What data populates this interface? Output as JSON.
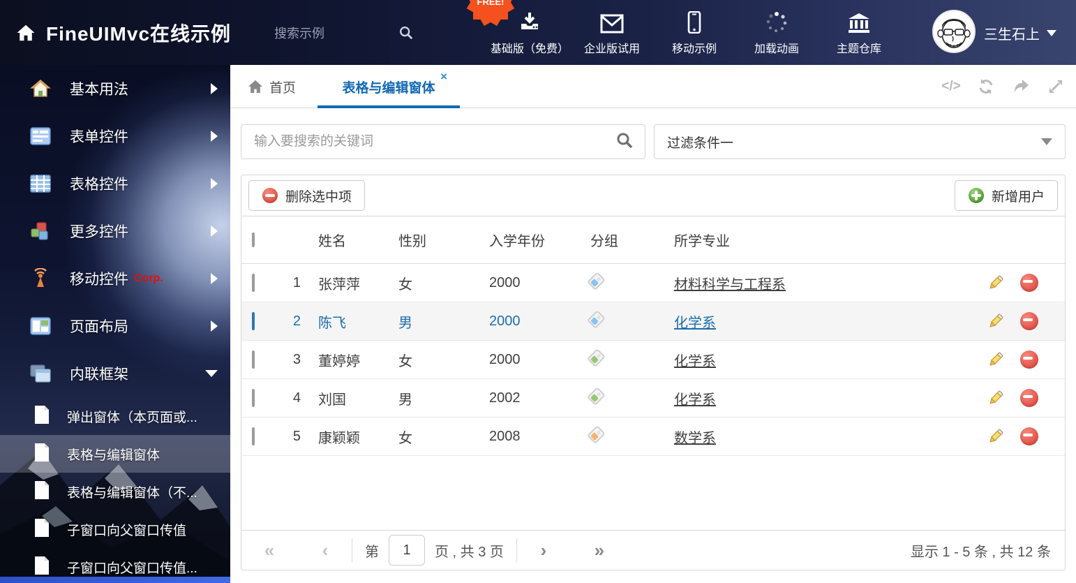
{
  "header": {
    "title": "FineUIMvc在线示例",
    "search_placeholder": "搜索示例",
    "badge": "FREE!",
    "nav": [
      {
        "label": "基础版（免费）"
      },
      {
        "label": "企业版试用"
      },
      {
        "label": "移动示例"
      },
      {
        "label": "加载动画"
      },
      {
        "label": "主题仓库"
      }
    ],
    "user_name": "三生石上"
  },
  "sidebar": {
    "items": [
      {
        "label": "基本用法"
      },
      {
        "label": "表单控件"
      },
      {
        "label": "表格控件"
      },
      {
        "label": "更多控件"
      },
      {
        "label": "移动控件",
        "suffix": "Corp."
      },
      {
        "label": "页面布局"
      },
      {
        "label": "内联框架"
      }
    ],
    "subitems": [
      {
        "label": "弹出窗体（本页面或..."
      },
      {
        "label": "表格与编辑窗体"
      },
      {
        "label": "表格与编辑窗体（不..."
      },
      {
        "label": "子窗口向父窗口传值"
      },
      {
        "label": "子窗口向父窗口传值..."
      }
    ]
  },
  "tabs": {
    "home": "首页",
    "active": "表格与编辑窗体",
    "close": "×"
  },
  "toolbar": {
    "code_label": "</>"
  },
  "filters": {
    "search_placeholder": "输入要搜索的关键词",
    "dropdown_value": "过滤条件一"
  },
  "grid": {
    "delete_button": "删除选中项",
    "add_button": "新增用户",
    "columns": {
      "name": "姓名",
      "gender": "性别",
      "year": "入学年份",
      "group": "分组",
      "major": "所学专业"
    },
    "rows": [
      {
        "index": "1",
        "name": "张萍萍",
        "gender": "女",
        "year": "2000",
        "tag_color": "#89c4f0",
        "major": "材料科学与工程系"
      },
      {
        "index": "2",
        "name": "陈飞",
        "gender": "男",
        "year": "2000",
        "tag_color": "#89c4f0",
        "major": "化学系"
      },
      {
        "index": "3",
        "name": "董婷婷",
        "gender": "女",
        "year": "2000",
        "tag_color": "#97c776",
        "major": "化学系"
      },
      {
        "index": "4",
        "name": "刘国",
        "gender": "男",
        "year": "2002",
        "tag_color": "#97c776",
        "major": "化学系"
      },
      {
        "index": "5",
        "name": "康颖颖",
        "gender": "女",
        "year": "2008",
        "tag_color": "#f6b471",
        "major": "数学系"
      }
    ]
  },
  "pagination": {
    "first": "«",
    "prev": "‹",
    "next": "›",
    "last": "»",
    "label_prefix": "第",
    "page_value": "1",
    "label_suffix": "页 , 共 3 页",
    "summary": "显示 1 - 5 条 , 共 12 条"
  },
  "colors": {
    "accent_blue": "#1268b3",
    "selected_text": "#1b6eae",
    "danger_red": "#e4554a",
    "success_green": "#5aa73c",
    "corp_red": "#e01010",
    "badge_orange": "#f4511e"
  }
}
